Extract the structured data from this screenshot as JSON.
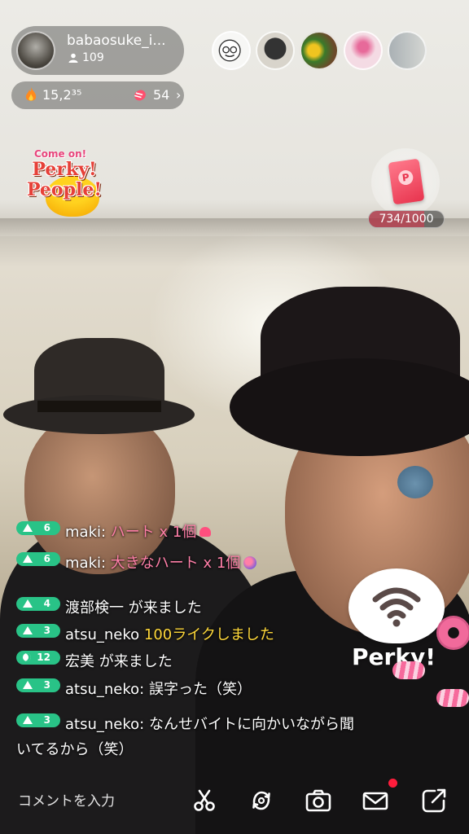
{
  "host": {
    "name": "babaosuke_i...",
    "viewers": "109"
  },
  "stats": {
    "fire_value": "15,2³⁵",
    "candy_value": "54",
    "chevron": "›"
  },
  "audience": [
    {
      "name": "audience-avatar-1"
    },
    {
      "name": "audience-avatar-2"
    },
    {
      "name": "audience-avatar-3"
    },
    {
      "name": "audience-avatar-4"
    },
    {
      "name": "audience-avatar-5"
    }
  ],
  "badge": {
    "line1": "Come on!",
    "line2": "Perky!",
    "line3": "People!"
  },
  "gift": {
    "progress_text": "734/1000",
    "progress_value": 734,
    "progress_max": 1000
  },
  "chat": [
    {
      "level": "6",
      "user": "maki",
      "sep": ": ",
      "text": "ハート x 1個"
    },
    {
      "level": "6",
      "user": "maki",
      "sep": ": ",
      "text": "大きなハート x 1個"
    },
    {
      "level": "4",
      "user": "渡部検一",
      "sep": " ",
      "text": "が来ました"
    },
    {
      "level": "3",
      "user": "atsu_neko",
      "sep": " ",
      "text": "100ライクしました"
    },
    {
      "level": "12",
      "user": "宏美",
      "sep": " ",
      "text": "が来ました"
    },
    {
      "level": "3",
      "user": "atsu_neko",
      "sep": ": ",
      "text": "誤字った（笑）"
    },
    {
      "level": "3",
      "user": "atsu_neko",
      "sep": ": ",
      "text": "なんせバイトに向かいながら聞いてるから（笑）"
    }
  ],
  "perky_logo": {
    "word": "Perky!"
  },
  "bottom": {
    "comment_placeholder": "コメントを入力"
  },
  "colors": {
    "level_badge": "#29c387",
    "pink_highlight": "#ff7fa8",
    "yellow_highlight": "#ffd83a",
    "notify_dot": "#ff1d3c"
  }
}
